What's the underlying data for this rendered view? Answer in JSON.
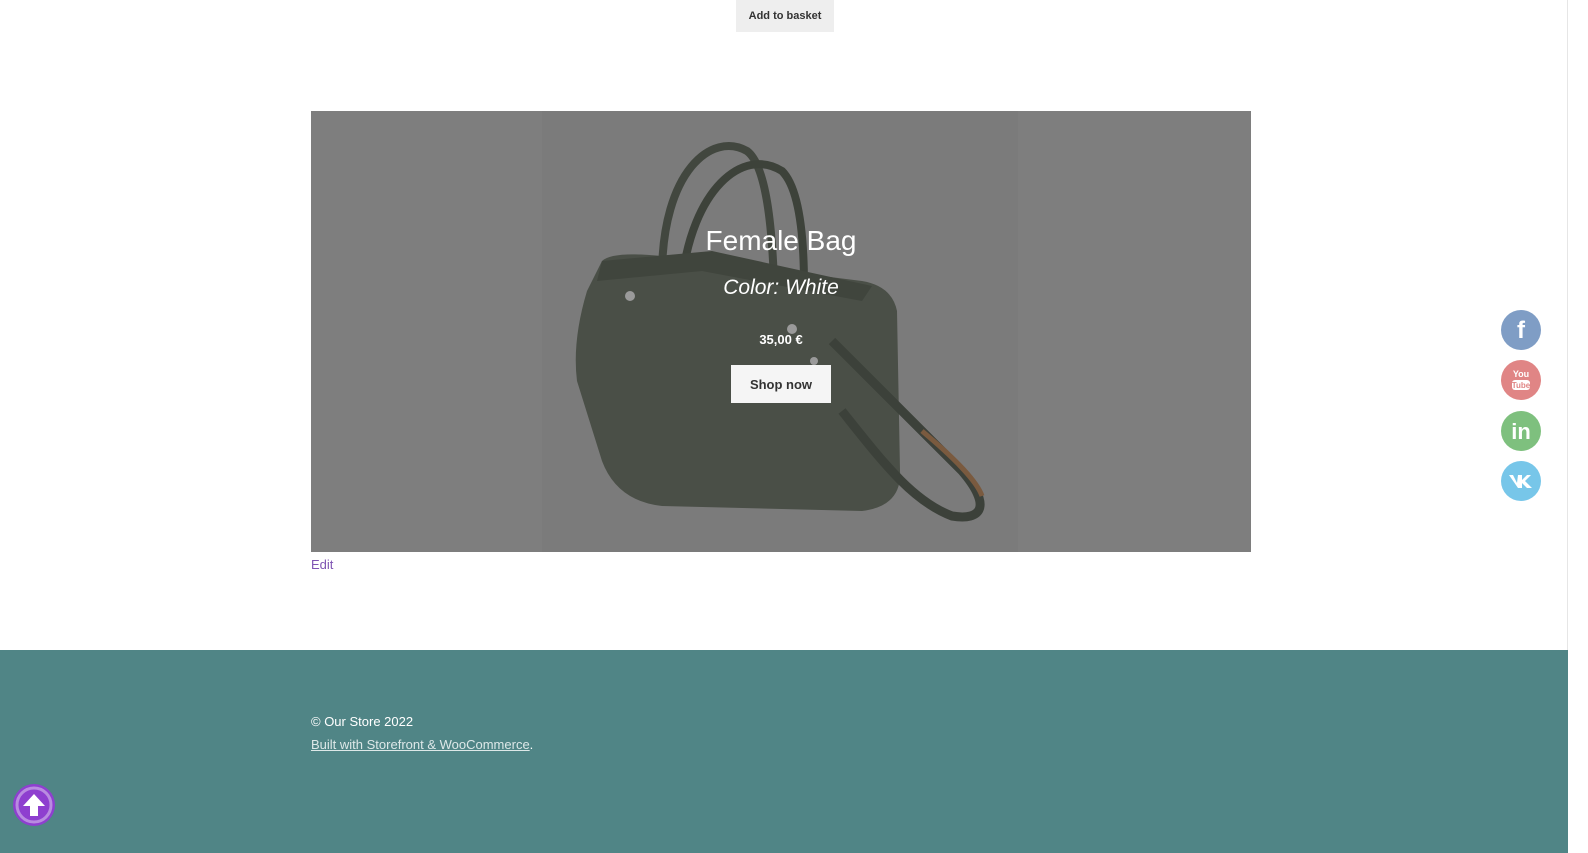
{
  "product_top": {
    "add_to_basket_label": "Add to basket"
  },
  "hero": {
    "title": "Female Bag",
    "subtitle": "Color: White",
    "price": "35,00 €",
    "shop_now_label": "Shop now",
    "background_color": "#7e7e7e",
    "bag_color": "#4a4f47"
  },
  "edit_link": "Edit",
  "footer": {
    "copyright": "© Our Store 2022",
    "built_with_link": "Built with Storefront & WooCommerce",
    "built_with_suffix": ".",
    "background_color": "#508586"
  },
  "social": [
    {
      "name": "facebook-icon",
      "glyph": "f",
      "color": "#7f9dc5"
    },
    {
      "name": "youtube-icon",
      "glyph": "You\nTube",
      "color": "#e08585"
    },
    {
      "name": "linkedin-icon",
      "glyph": "in",
      "color": "#7ec07e"
    },
    {
      "name": "vk-icon",
      "glyph": "vk",
      "color": "#77c6e9"
    }
  ],
  "back_to_top_color": "#8e3fcf"
}
